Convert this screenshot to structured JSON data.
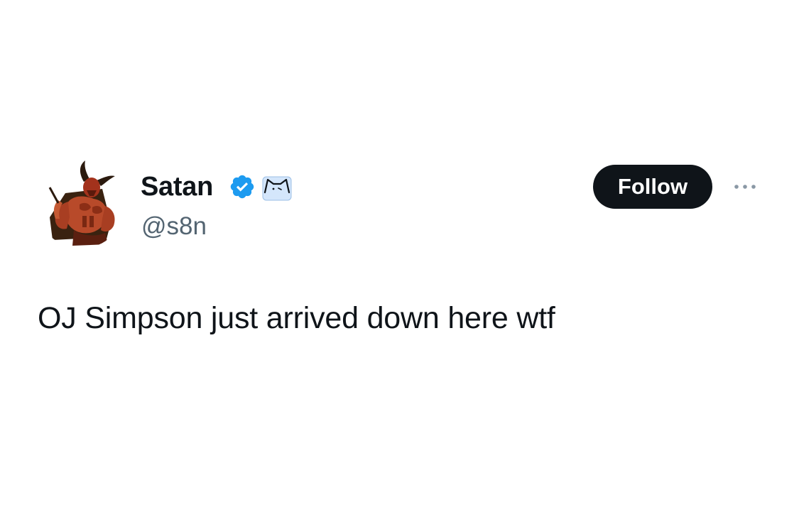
{
  "author": {
    "display_name": "Satan",
    "handle": "@s8n",
    "avatar_icon": "devil-avatar",
    "verified": true,
    "verified_color": "#1d9bf0",
    "affiliate_badge_icon": "cat-icon"
  },
  "actions": {
    "follow_label": "Follow",
    "more_icon": "more-icon"
  },
  "tweet": {
    "text": "OJ Simpson just arrived down here wtf"
  },
  "colors": {
    "text_primary": "#0f1419",
    "text_secondary": "#536471",
    "follow_bg": "#0f1419",
    "follow_text": "#ffffff",
    "background": "#ffffff"
  }
}
